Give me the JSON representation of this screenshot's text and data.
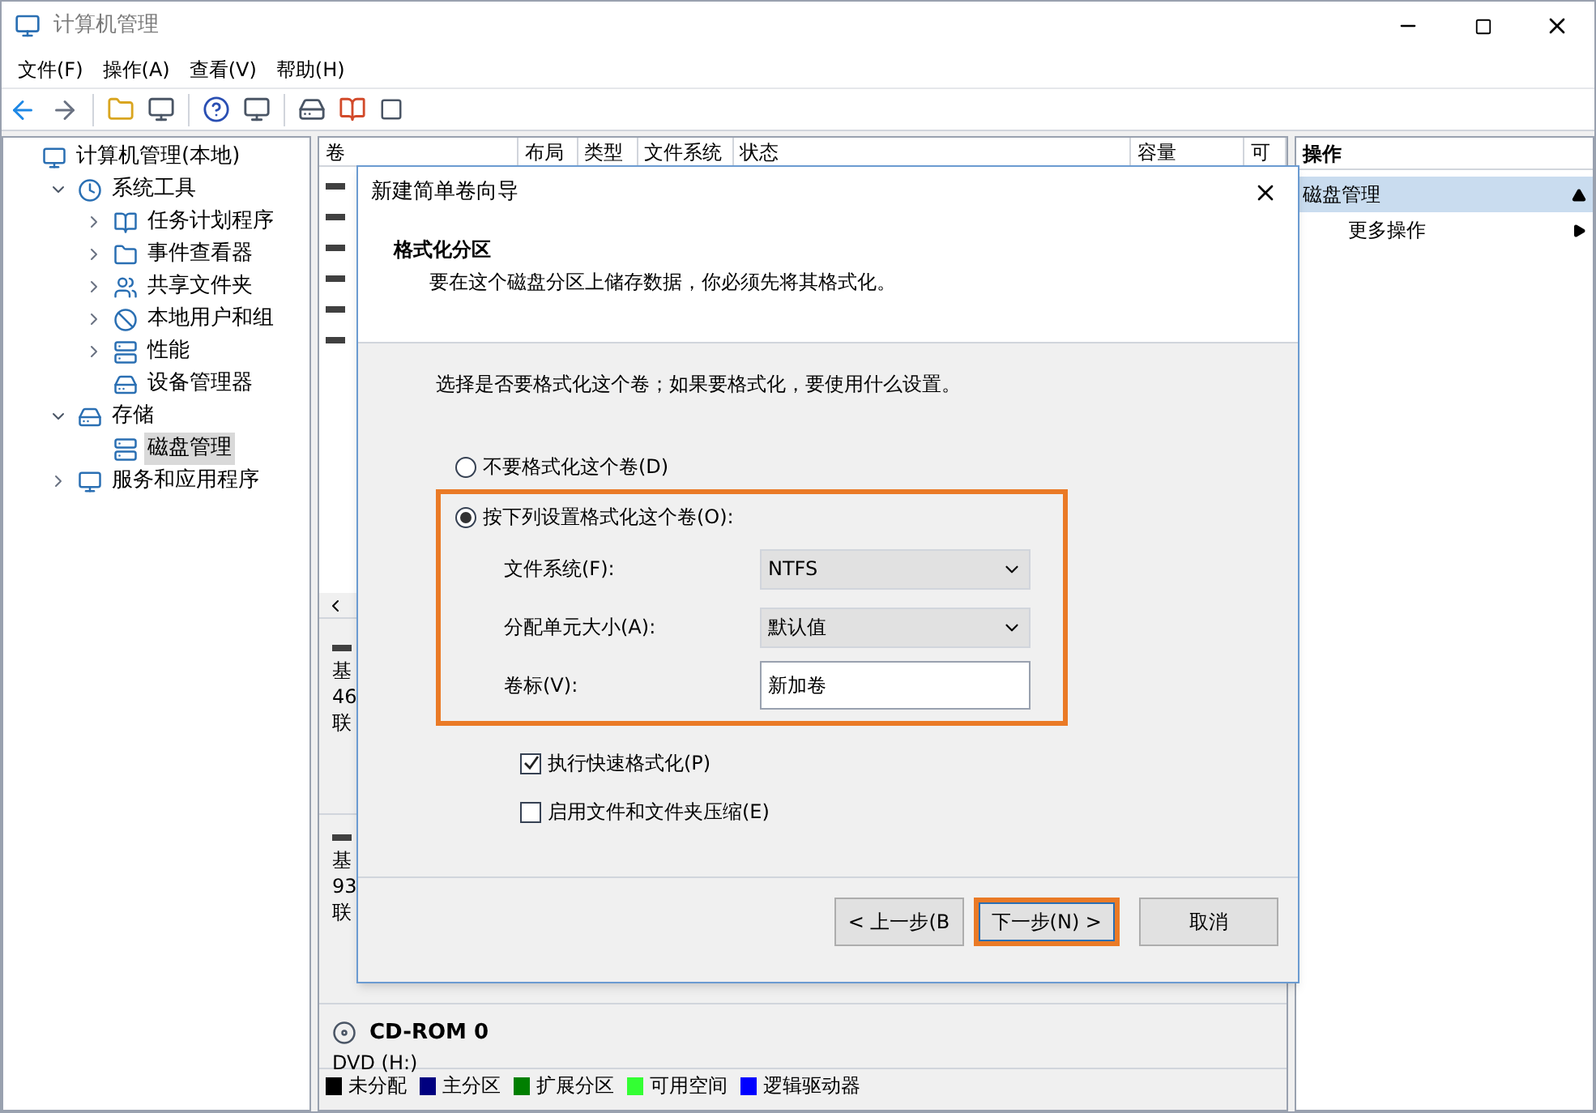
{
  "window": {
    "title": "计算机管理"
  },
  "menu": [
    "文件(F)",
    "操作(A)",
    "查看(V)",
    "帮助(H)"
  ],
  "tree": {
    "label": "计算机管理(本地)",
    "selected": false,
    "children": [
      {
        "label": "系统工具",
        "expanded": true,
        "selected": false,
        "children": [
          {
            "label": "任务计划程序",
            "expanded": false,
            "selected": false
          },
          {
            "label": "事件查看器",
            "expanded": false,
            "selected": false
          },
          {
            "label": "共享文件夹",
            "expanded": false,
            "selected": false
          },
          {
            "label": "本地用户和组",
            "expanded": false,
            "selected": false
          },
          {
            "label": "性能",
            "expanded": false,
            "selected": false
          },
          {
            "label": "设备管理器",
            "selected": false
          }
        ]
      },
      {
        "label": "存储",
        "expanded": true,
        "selected": false,
        "children": [
          {
            "label": "磁盘管理",
            "selected": true
          }
        ]
      },
      {
        "label": "服务和应用程序",
        "expanded": false,
        "selected": false
      }
    ]
  },
  "table": {
    "columns": [
      "卷",
      "布局",
      "类型",
      "文件系统",
      "状态",
      "容量",
      "可"
    ]
  },
  "disks": [
    {
      "kind": "disk",
      "lines": [
        "基",
        "46",
        "联"
      ]
    },
    {
      "kind": "disk",
      "lines": [
        "基",
        "93",
        "联"
      ]
    },
    {
      "kind": "cdrom",
      "name": "CD-ROM 0",
      "lines": [
        "DVD (H:)"
      ]
    }
  ],
  "legend": [
    {
      "label": "未分配",
      "color": "#000000"
    },
    {
      "label": "主分区",
      "color": "#00007f"
    },
    {
      "label": "扩展分区",
      "color": "#007f00"
    },
    {
      "label": "可用空间",
      "color": "#33ff33"
    },
    {
      "label": "逻辑驱动器",
      "color": "#0000ff"
    }
  ],
  "actions": {
    "title": "操作",
    "items": [
      {
        "label": "磁盘管理",
        "kind": "section"
      },
      {
        "label": "更多操作",
        "kind": "submenu"
      }
    ]
  },
  "dialog": {
    "title": "新建简单卷向导",
    "heading": "格式化分区",
    "subheading": "要在这个磁盘分区上储存数据，你必须先将其格式化。",
    "prompt": "选择是否要格式化这个卷；如果要格式化，要使用什么设置。",
    "options": [
      {
        "label": "不要格式化这个卷(D)",
        "selected": false,
        "highlighted": false
      },
      {
        "label": "按下列设置格式化这个卷(O):",
        "selected": true,
        "highlighted": true
      }
    ],
    "fields": [
      {
        "label": "文件系统(F):",
        "kind": "select",
        "value": "NTFS"
      },
      {
        "label": "分配单元大小(A):",
        "kind": "select",
        "value": "默认值"
      },
      {
        "label": "卷标(V):",
        "kind": "text",
        "value": "新加卷"
      }
    ],
    "checkboxes": [
      {
        "label": "执行快速格式化(P)",
        "checked": true
      },
      {
        "label": "启用文件和文件夹压缩(E)",
        "checked": false
      }
    ],
    "buttons": [
      {
        "label": "< 上一步(B",
        "highlighted": false
      },
      {
        "label": "下一步(N) >",
        "highlighted": true
      },
      {
        "label": "取消",
        "highlighted": false
      }
    ]
  }
}
